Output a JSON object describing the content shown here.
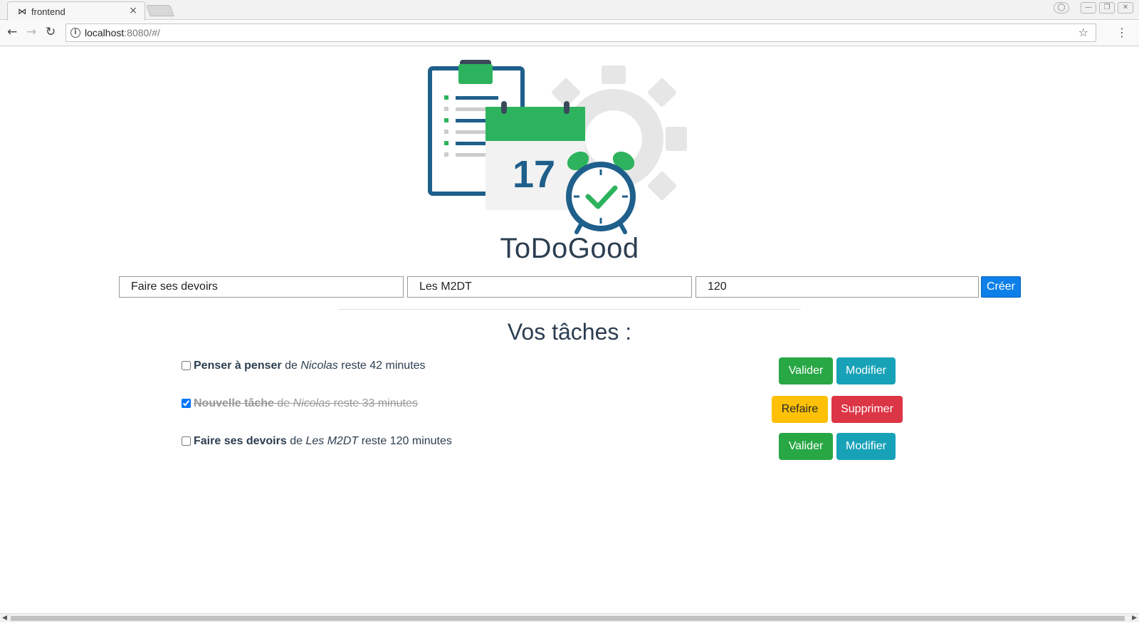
{
  "browser": {
    "tab_title": "frontend",
    "tab_favicon": "bowtie-icon",
    "url_host": "localhost",
    "url_rest": ":8080/#/"
  },
  "icons": {
    "back": "←",
    "forward": "→",
    "reload": "↻",
    "info": "i",
    "star": "☆",
    "menu": "⋮",
    "close": "×",
    "favicon": "⋈",
    "profile": "◯",
    "minimize": "—",
    "restore": "❐",
    "win_close": "✕",
    "scroll_left": "◀",
    "scroll_right": "▶"
  },
  "app": {
    "title": "ToDoGood",
    "logo_number": "17"
  },
  "form": {
    "task_name": "Faire ses devoirs",
    "owner": "Les M2DT",
    "duration": "120",
    "create_label": "Créer"
  },
  "section_title": "Vos tâches :",
  "tasks": [
    {
      "name": "Penser à penser",
      "de": "de",
      "owner": "Nicolas",
      "reste": "reste 42 minutes",
      "done": false,
      "primary_label": "Valider",
      "secondary_label": "Modifier"
    },
    {
      "name": "Nouvelle tâche",
      "de": "de",
      "owner": "Nicolas",
      "reste": "reste 33 minutes",
      "done": true,
      "primary_label": "Refaire",
      "secondary_label": "Supprimer"
    },
    {
      "name": "Faire ses devoirs",
      "de": "de",
      "owner": "Les M2DT",
      "reste": "reste 120 minutes",
      "done": false,
      "primary_label": "Valider",
      "secondary_label": "Modifier"
    }
  ],
  "colors": {
    "valider": "#28a745",
    "modifier": "#17a2b8",
    "refaire": "#ffc107",
    "supprimer": "#dc3545",
    "creer": "#0d7fe8",
    "logo_blue": "#1f5f8b",
    "logo_green": "#2db35d",
    "logo_grey": "#e6e6e6"
  }
}
